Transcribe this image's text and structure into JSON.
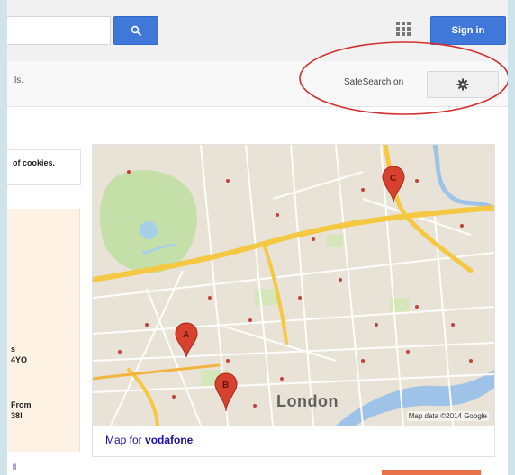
{
  "header": {
    "search_button_icon": "search-icon",
    "apps_icon": "apps-grid-icon",
    "signin_label": "Sign in"
  },
  "subbar": {
    "left_text": "ls.",
    "safesearch_label": "SafeSearch on",
    "settings_icon": "gear-icon"
  },
  "left_column": {
    "cookie_text": "of cookies.",
    "ad_text_1": "s\n4YO",
    "ad_text_2": "From\n38!",
    "foot_link": "ll"
  },
  "map": {
    "city_label": "London",
    "attribution": "Map data ©2014 Google",
    "caption_prefix": "Map for ",
    "caption_query": "vodafone",
    "pins": [
      {
        "label": "A"
      },
      {
        "label": "B"
      },
      {
        "label": "C"
      }
    ]
  },
  "colors": {
    "primary_blue": "#3f78d8",
    "annotation_red": "#d32f2f",
    "map_background": "#e8e3d6",
    "park_green": "#c5dfa8",
    "river_blue": "#9ec2e8",
    "road_yellow": "#f5c844",
    "pin_red": "#d9412f",
    "link_blue": "#1a0dab"
  }
}
